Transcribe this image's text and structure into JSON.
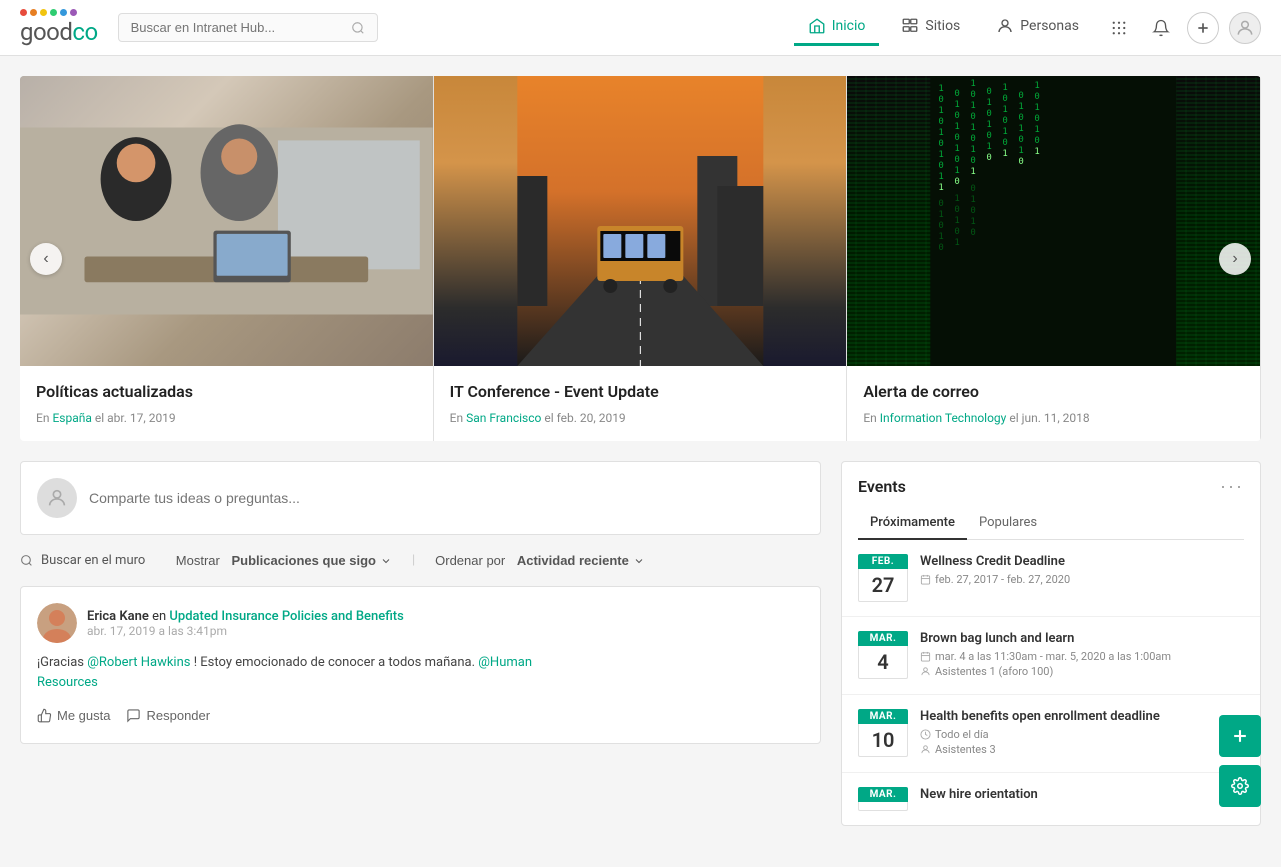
{
  "header": {
    "logo_text_main": "goodco",
    "search_placeholder": "Buscar en Intranet Hub...",
    "nav": [
      {
        "label": "Inicio",
        "id": "inicio",
        "active": true
      },
      {
        "label": "Sitios",
        "id": "sitios",
        "active": false
      },
      {
        "label": "Personas",
        "id": "personas",
        "active": false
      }
    ]
  },
  "carousel": {
    "items": [
      {
        "title": "Políticas actualizadas",
        "meta_prefix": "En",
        "meta_link": "España",
        "meta_date": "el abr. 17, 2019",
        "img_type": "office"
      },
      {
        "title": "IT Conference - Event Update",
        "meta_prefix": "En",
        "meta_link": "San Francisco",
        "meta_date": "el feb. 20, 2019",
        "img_type": "sf"
      },
      {
        "title": "Alerta de correo",
        "meta_prefix": "En",
        "meta_link": "Information Technology",
        "meta_date": "el jun. 11, 2018",
        "img_type": "matrix"
      }
    ]
  },
  "post_box": {
    "placeholder": "Comparte tus ideas o preguntas..."
  },
  "feed_controls": {
    "search_label": "Buscar en el muro",
    "show_label": "Mostrar",
    "filter_label": "Publicaciones que sigo",
    "sort_label": "Ordenar por",
    "sort_value": "Actividad reciente"
  },
  "posts": [
    {
      "user_name": "Erica Kane",
      "post_link_text": "Updated Insurance Policies and Benefits",
      "time": "abr. 17, 2019 a las 3:41pm",
      "body_text": "¡Gracias @Robert Hawkins ! Estoy emocionado de conocer a todos mañana. @Human Resources",
      "mention1": "@Robert Hawkins",
      "mention2": "@Human Resources",
      "like_label": "Me gusta",
      "reply_label": "Responder"
    }
  ],
  "events": {
    "title": "Events",
    "tabs": [
      {
        "label": "Próximamente",
        "active": true
      },
      {
        "label": "Populares",
        "active": false
      }
    ],
    "items": [
      {
        "month": "FEB.",
        "day": "27",
        "name": "Wellness Credit Deadline",
        "date_range": "feb. 27, 2017 - feb. 27, 2020",
        "meta_type": "calendar"
      },
      {
        "month": "MAR.",
        "day": "4",
        "name": "Brown bag lunch and learn",
        "date_range": "mar. 4 a las 11:30am - mar. 5, 2020 a las 1:00am",
        "attendees": "Asistentes 1 (aforo 100)",
        "meta_type": "calendar"
      },
      {
        "month": "MAR.",
        "day": "10",
        "name": "Health benefits open enrollment deadline",
        "date_range": "Todo el día",
        "attendees": "Asistentes 3",
        "meta_type": "clock"
      },
      {
        "month": "MAR.",
        "day": "",
        "name": "New hire orientation",
        "date_range": "",
        "attendees": "",
        "meta_type": "calendar"
      }
    ]
  }
}
